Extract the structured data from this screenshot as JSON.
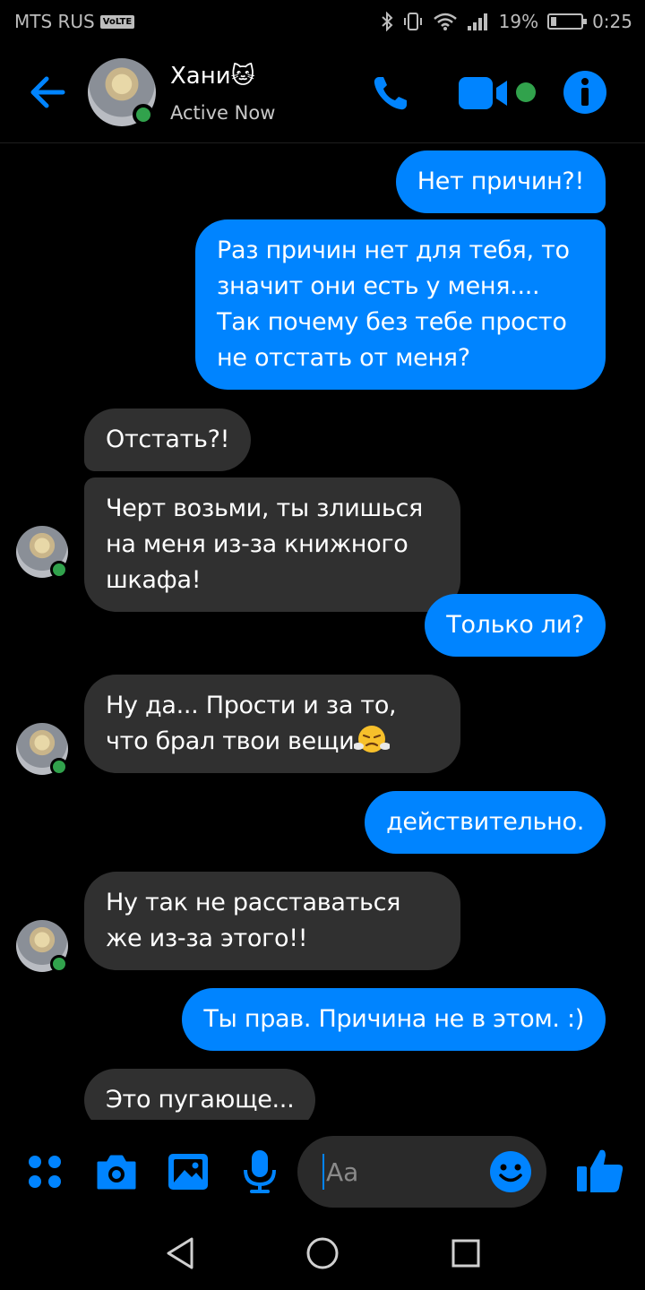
{
  "status_bar": {
    "carrier": "MTS RUS",
    "volte": "VoLTE",
    "battery": "19%",
    "battery_level": 0.19,
    "time": "0:25"
  },
  "header": {
    "contact_name": "Хани🐱",
    "status": "Active Now"
  },
  "messages": [
    {
      "direction": "out",
      "text": "Нет причин?!"
    },
    {
      "direction": "out",
      "text": "Раз причин нет для тебя, то значит они есть у меня.... Так почему без тебе просто не отстать от меня?"
    },
    {
      "direction": "in",
      "text": "Отстать?!"
    },
    {
      "direction": "in",
      "text": "Черт возьми, ты злишься на меня из-за книжного шкафа!"
    },
    {
      "direction": "out",
      "text": "Только ли?"
    },
    {
      "direction": "in",
      "text": "Ну да... Прости и за то, что брал твои вещи"
    },
    {
      "direction": "out",
      "text": "действительно."
    },
    {
      "direction": "in",
      "text": "Ну так не расставаться же из-за этого!!"
    },
    {
      "direction": "out",
      "text": "Ты прав. Причина не в этом. :)"
    },
    {
      "direction": "in",
      "text": "Это пугающе..."
    }
  ],
  "composer": {
    "placeholder": "Aa"
  },
  "colors": {
    "accent": "#0084ff",
    "incoming_bubble": "#303030",
    "online": "#31a24c",
    "background": "#000000"
  },
  "icons": [
    "back-arrow-icon",
    "phone-icon",
    "video-camera-icon",
    "info-icon",
    "apps-grid-icon",
    "camera-icon",
    "image-icon",
    "microphone-icon",
    "emoji-icon",
    "thumbs-up-icon",
    "nav-back-icon",
    "nav-home-icon",
    "nav-recents-icon"
  ]
}
